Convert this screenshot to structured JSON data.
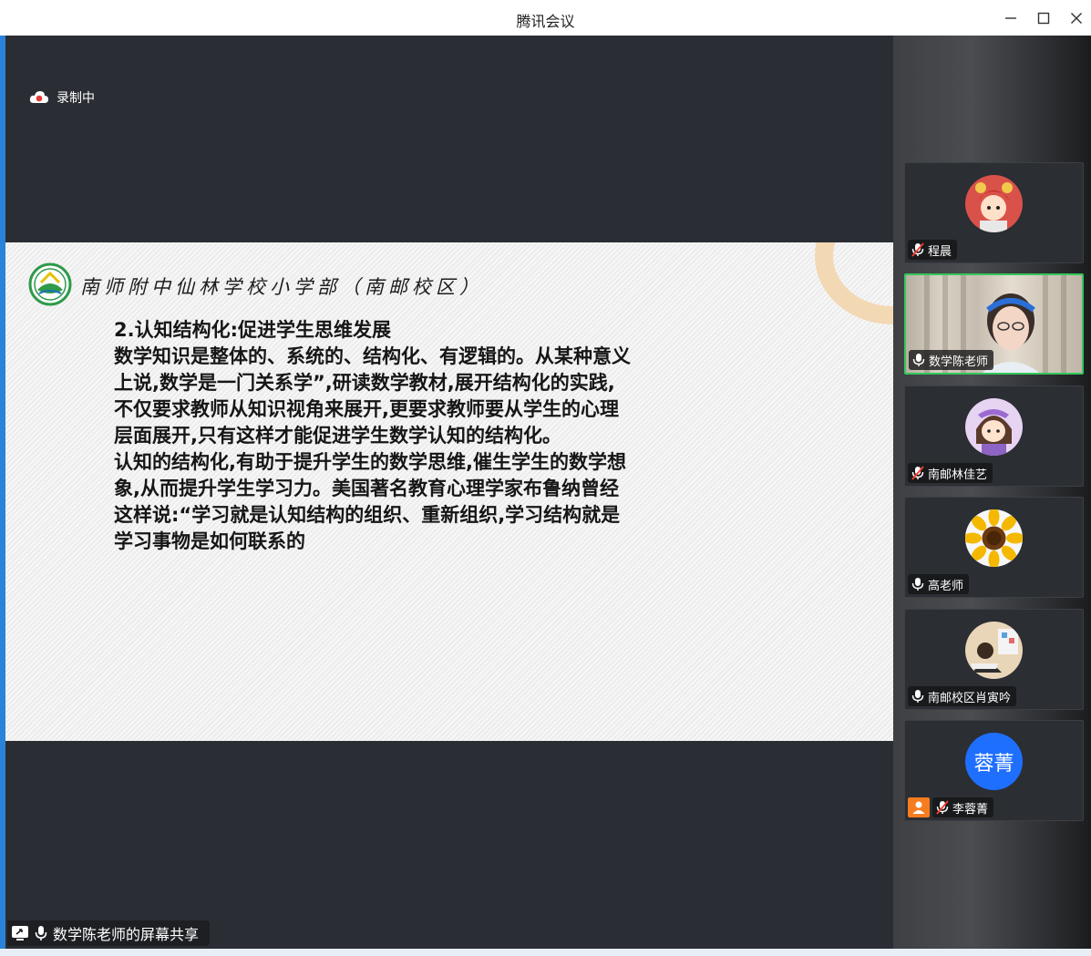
{
  "window": {
    "title": "腾讯会议"
  },
  "recording": {
    "label": "录制中",
    "icon": "cloud-record-icon",
    "color": "#e53935"
  },
  "slide": {
    "school_name": "南师附中仙林学校小学部（南邮校区）",
    "lines": [
      "2.认知结构化:促进学生思维发展",
      "数学知识是整体的、系统的、结构化、有逻辑的。从某种意义",
      "上说,数学是一门关系学”,研读数学教材,展开结构化的实践,",
      "不仅要求教师从知识视角来展开,更要求教师要从学生的心理",
      "层面展开,只有这样才能促进学生数学认知的结构化。",
      "认知的结构化,有助于提升学生的数学思维,催生学生的数学想",
      "象,从而提升学生学习力。美国著名教育心理学家布鲁纳曾经",
      "这样说:“学习就是认知结构的组织、重新组织,学习结构就是",
      "学习事物是如何联系的"
    ]
  },
  "screen_share": {
    "label": "数学陈老师的屏幕共享"
  },
  "participants": [
    {
      "name": "程晨",
      "mic": "muted",
      "avatar": "cartoon-girl-avatar"
    },
    {
      "name": "数学陈老师",
      "mic": "on",
      "avatar": "live-video",
      "active": true
    },
    {
      "name": "南邮林佳艺",
      "mic": "muted",
      "avatar": "cartoon-girl-purple-avatar"
    },
    {
      "name": "高老师",
      "mic": "on",
      "avatar": "sunflower-avatar"
    },
    {
      "name": "南邮校区肖寅吟",
      "mic": "on",
      "avatar": "child-photo-avatar"
    },
    {
      "name": "李蓉菁",
      "mic": "muted",
      "avatar": "text-avatar",
      "avatar_text": "蓉菁",
      "avatar_color": "#1f6fff",
      "host": true
    }
  ],
  "colors": {
    "main_bg": "#2a2d33",
    "accent_blue": "#2a83d8",
    "active_border": "#34c759",
    "host_badge": "#f57c1f"
  }
}
